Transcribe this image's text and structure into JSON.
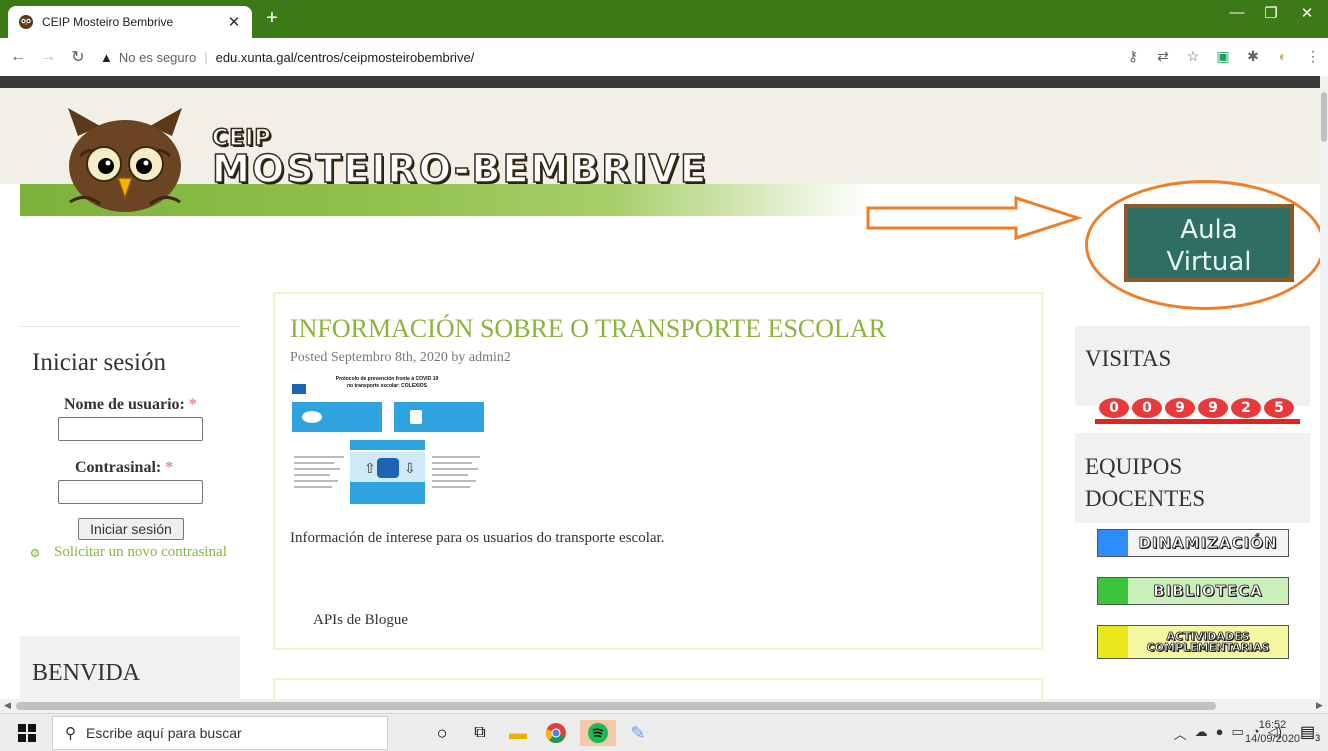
{
  "browser": {
    "tab_title": "CEIP Mosteiro Bembrive",
    "security_label": "No es seguro",
    "url": "edu.xunta.gal/centros/ceipmosteirobembrive/"
  },
  "site": {
    "title_small": "CEIP",
    "title_big": "MOSTEIRO-BEMBRIVE",
    "aula_line1": "Aula",
    "aula_line2": "Virtual"
  },
  "login": {
    "heading": "Iniciar sesión",
    "username_label": "Nome de usuario:",
    "password_label": "Contrasinal:",
    "required_mark": "*",
    "button": "Iniciar sesión",
    "reset_link": "Solicitar un novo contrasinal"
  },
  "welcome": {
    "heading": "BENVIDA"
  },
  "post": {
    "title": "INFORMACIÓN SOBRE O TRANSPORTE ESCOLAR",
    "meta": "Posted Septembro 8th, 2020 by admin2",
    "image_title_1": "Protocolo de prevención fronte á COVID 19",
    "image_title_2": "no transporte escolar: COLEXIOS",
    "body": "Información de interese para os usuarios do transporte escolar.",
    "footer_link": "APIs de Blogue"
  },
  "visits": {
    "heading": "VISITAS",
    "digits": [
      "0",
      "0",
      "9",
      "9",
      "2",
      "5"
    ]
  },
  "teams": {
    "heading": "EQUIPOS DOCENTES",
    "buttons": [
      {
        "label": "DINAMIZACIÓN",
        "color": "#2f8cff"
      },
      {
        "label": "BIBLIOTECA",
        "color": "#3cc43c"
      },
      {
        "label": "ACTIVIDADES COMPLEMENTARIAS",
        "color": "#e8e81c"
      }
    ]
  },
  "taskbar": {
    "search_placeholder": "Escribe aquí para buscar",
    "time": "16:52",
    "date": "14/09/2020",
    "notification_count": "3"
  },
  "colors": {
    "tab_strip": "#3b7a16",
    "post_title": "#8bb43d",
    "aula_ring": "#f07d28",
    "counter_red": "#e83a3a"
  }
}
